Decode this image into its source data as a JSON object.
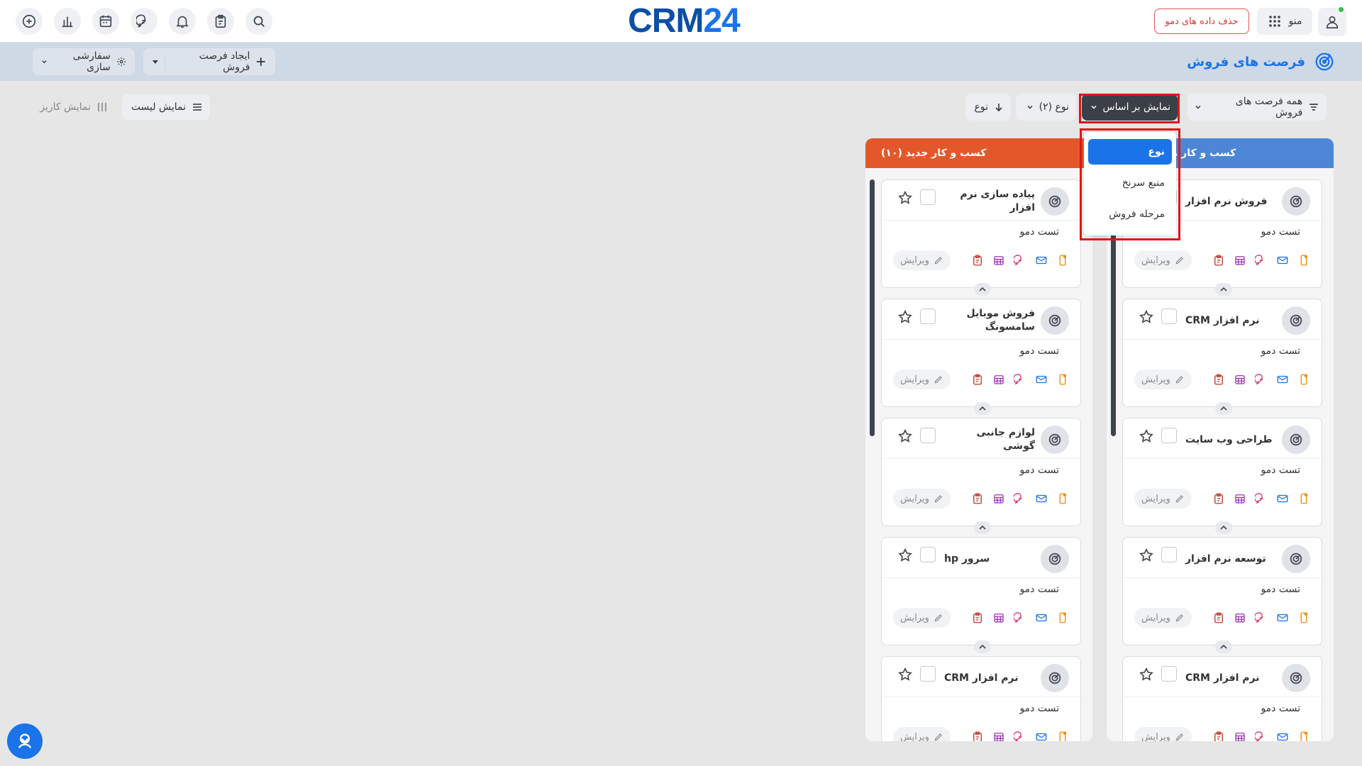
{
  "app": {
    "logo_crm": "CRM",
    "logo_num": "24"
  },
  "topbar": {
    "demo_delete": "حذف داده های دمو",
    "menu_label": "منو",
    "left_icons": [
      "add-circle-icon",
      "chart-icon",
      "calendar-icon",
      "chat-icon",
      "bell-icon",
      "clipboard-icon",
      "search-icon"
    ]
  },
  "subbar": {
    "title": "فرصت های فروش",
    "create_label": "ایجاد فرصت فروش",
    "customize_label": "سفارشی سازی"
  },
  "filters": {
    "all_opps": "همه فرصت های فروش",
    "view_by": "نمایش بر اساس",
    "type_count": "نوع (۲)",
    "sort_type": "نوع",
    "list_view": "نمایش لیست",
    "kanban_view": "نمایش کاریز"
  },
  "dropdown": {
    "items": [
      "نوع",
      "منبع سرنخ",
      "مرحله فروش"
    ],
    "selected": "نوع"
  },
  "columns": [
    {
      "title": "کسب و کار موجود (۱۵)",
      "color": "#4d86d6",
      "cards": [
        {
          "title": "فروش نرم افزار",
          "subtitle": "تست دمو",
          "edit": "ویرایش"
        },
        {
          "title": "نرم افزار CRM",
          "subtitle": "تست دمو",
          "edit": "ویرایش"
        },
        {
          "title": "طراحی وب سایت",
          "subtitle": "تست دمو",
          "edit": "ویرایش"
        },
        {
          "title": "توسعه نرم افزار",
          "subtitle": "تست دمو",
          "edit": "ویرایش"
        },
        {
          "title": "نرم افزار CRM",
          "subtitle": "تست دمو",
          "edit": "ویرایش"
        }
      ]
    },
    {
      "title": "کسب و کار جدید (۱۰)",
      "color": "#e3582a",
      "cards": [
        {
          "title": "پیاده سازی نرم افزار",
          "subtitle": "تست دمو",
          "edit": "ویرایش"
        },
        {
          "title": "فروش موبایل سامسونگ",
          "subtitle": "تست دمو",
          "edit": "ویرایش"
        },
        {
          "title": "لوازم جانبی گوشی",
          "subtitle": "تست دمو",
          "edit": "ویرایش"
        },
        {
          "title": "سرور hp",
          "subtitle": "تست دمو",
          "edit": "ویرایش"
        },
        {
          "title": "نرم افزار CRM",
          "subtitle": "تست دمو",
          "edit": "ویرایش"
        }
      ]
    }
  ]
}
